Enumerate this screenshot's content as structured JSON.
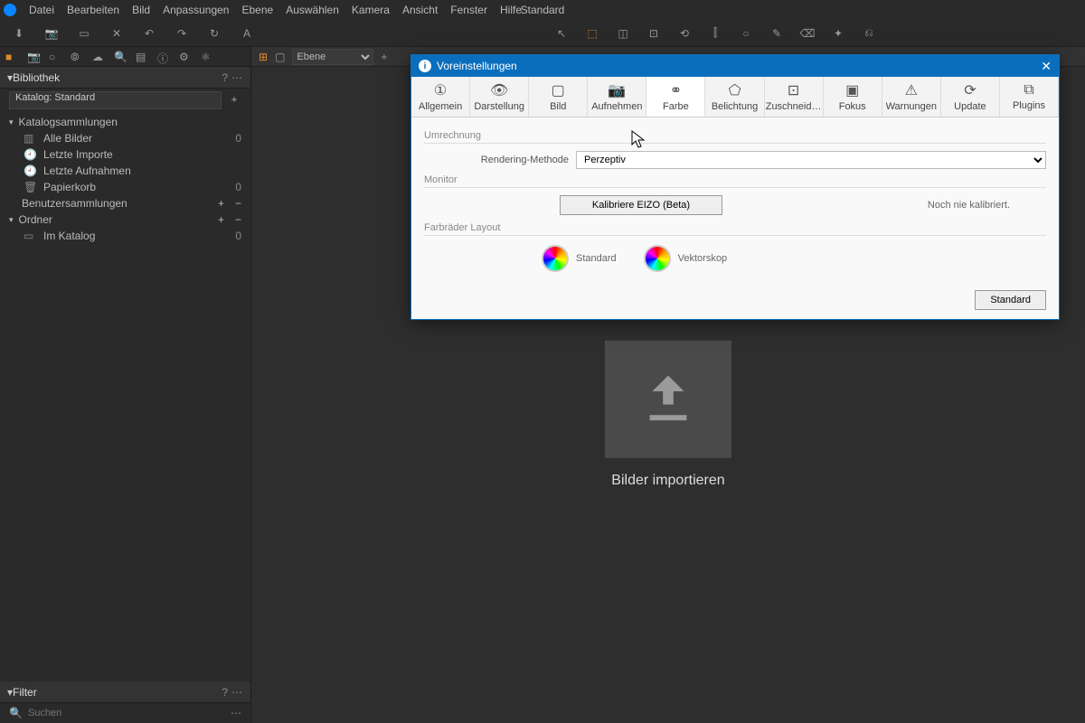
{
  "menu": {
    "items": [
      "Datei",
      "Bearbeiten",
      "Bild",
      "Anpassungen",
      "Ebene",
      "Auswählen",
      "Kamera",
      "Ansicht",
      "Fenster",
      "Hilfe"
    ],
    "mode": "Standard"
  },
  "left": {
    "library_title": "Bibliothek",
    "catalog_label": "Katalog: Standard",
    "group1": "Katalogsammlungen",
    "items1": [
      {
        "label": "Alle Bilder",
        "count": "0"
      },
      {
        "label": "Letzte Importe",
        "count": ""
      },
      {
        "label": "Letzte Aufnahmen",
        "count": ""
      },
      {
        "label": "Papierkorb",
        "count": "0"
      }
    ],
    "group2": "Benutzersammlungen",
    "group3": "Ordner",
    "items3": [
      {
        "label": "Im Katalog",
        "count": "0"
      }
    ],
    "filter_title": "Filter",
    "search_placeholder": "Suchen"
  },
  "center": {
    "layer_label": "Ebene",
    "import_label": "Bilder importieren"
  },
  "dialog": {
    "title": "Voreinstellungen",
    "tabs": [
      "Allgemein",
      "Darstellung",
      "Bild",
      "Aufnehmen",
      "Farbe",
      "Belichtung",
      "Zuschneid…",
      "Fokus",
      "Warnungen",
      "Update",
      "Plugins"
    ],
    "active_tab": 4,
    "section1": "Umrechnung",
    "rendering_label": "Rendering-Methode",
    "rendering_value": "Perzeptiv",
    "section2": "Monitor",
    "calibrate_btn": "Kalibriere EIZO (Beta)",
    "calib_status": "Noch nie kalibriert.",
    "section3": "Farbräder Layout",
    "wheel1": "Standard",
    "wheel2": "Vektorskop",
    "footer_btn": "Standard"
  },
  "tab_icons": [
    "①",
    "👁",
    "▢",
    "📷",
    "⚭",
    "⬠",
    "⊡",
    "▣",
    "⚠",
    "⟳",
    "⧉"
  ]
}
